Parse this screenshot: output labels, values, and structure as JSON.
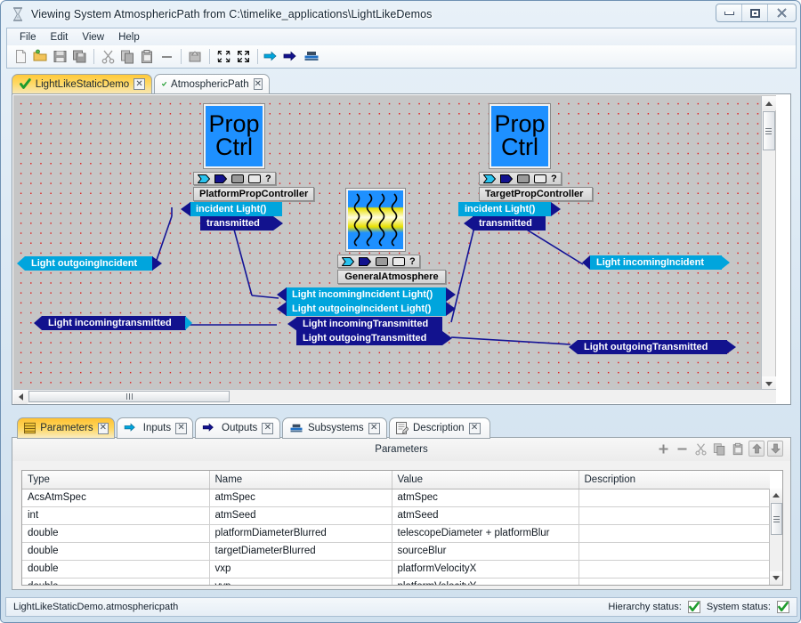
{
  "window": {
    "title": "Viewing System AtmosphericPath from C:\\timelike_applications\\LightLikeDemos",
    "title_icon": "hourglass-icon",
    "minimize_label": "Minimize",
    "maximize_label": "Maximize",
    "close_label": "Close"
  },
  "menu": {
    "items": [
      "File",
      "Edit",
      "View",
      "Help"
    ]
  },
  "toolbar": {
    "buttons": [
      {
        "name": "new-icon",
        "title": "New"
      },
      {
        "name": "open-folder-icon",
        "title": "Open"
      },
      {
        "name": "save-icon",
        "title": "Save"
      },
      {
        "name": "save-all-icon",
        "title": "Save All"
      },
      {
        "name": "cut-icon",
        "title": "Cut"
      },
      {
        "name": "copy-icon",
        "title": "Copy"
      },
      {
        "name": "paste-icon",
        "title": "Paste"
      },
      {
        "name": "delete-icon",
        "title": "Delete"
      },
      {
        "name": "promote-icon",
        "title": "Promote"
      },
      {
        "name": "collapse-icon",
        "title": "Collapse"
      },
      {
        "name": "expand-icon",
        "title": "Expand"
      },
      {
        "name": "input-port-icon",
        "title": "Add Input"
      },
      {
        "name": "output-port-icon",
        "title": "Add Output"
      },
      {
        "name": "subsystem-icon",
        "title": "Add Subsystem"
      }
    ]
  },
  "editor_tabs": [
    {
      "label": "LightLikeStaticDemo",
      "active": true,
      "status_icon": "green-check-icon",
      "close_icon": "close-icon"
    },
    {
      "label": "AtmosphericPath",
      "active": false,
      "status_icon": "green-check-icon",
      "close_icon": "close-icon"
    }
  ],
  "diagram": {
    "blocks": [
      {
        "id": "platform",
        "icon_lines": [
          "Prop",
          "Ctrl"
        ],
        "name": "PlatformPropController",
        "ports": [
          {
            "label": "incident  Light()",
            "style": "cyan",
            "dir": "in"
          },
          {
            "label": "transmitted",
            "style": "navy",
            "dir": "out"
          }
        ]
      },
      {
        "id": "atmosphere",
        "icon_lines": [],
        "name": "GeneralAtmosphere",
        "ports": [
          {
            "label": "Light  incomingIncident  Light()",
            "style": "cyan",
            "dir": "in"
          },
          {
            "label": "Light  outgoingIncident   Light()",
            "style": "cyan",
            "dir": "out"
          },
          {
            "label": "Light  incomingTransmitted",
            "style": "navy",
            "dir": "in"
          },
          {
            "label": "Light  outgoingTransmitted",
            "style": "navy",
            "dir": "out"
          }
        ]
      },
      {
        "id": "target",
        "icon_lines": [
          "Prop",
          "Ctrl"
        ],
        "name": "TargetPropController",
        "ports": [
          {
            "label": "incident  Light()",
            "style": "cyan",
            "dir": "in"
          },
          {
            "label": "transmitted",
            "style": "navy",
            "dir": "out"
          }
        ]
      }
    ],
    "system_ports": [
      {
        "label": "Light  outgoingIncident",
        "style": "cyan",
        "side": "left"
      },
      {
        "label": "Light  incomingtransmitted",
        "style": "navy",
        "side": "left"
      },
      {
        "label": "Light  incomingIncident",
        "style": "cyan",
        "side": "right"
      },
      {
        "label": "Light  outgoingTransmitted",
        "style": "navy",
        "side": "right"
      }
    ],
    "port_chip_legend": [
      "input-port-chip",
      "output-port-chip",
      "state-chip",
      "parameter-chip",
      "question-chip"
    ]
  },
  "bottom_tabs": [
    {
      "label": "Parameters",
      "active": true,
      "icon": "table-icon",
      "close_icon": "close-icon"
    },
    {
      "label": "Inputs",
      "active": false,
      "icon": "input-port-icon",
      "close_icon": "close-icon"
    },
    {
      "label": "Outputs",
      "active": false,
      "icon": "output-port-icon",
      "close_icon": "close-icon"
    },
    {
      "label": "Subsystems",
      "active": false,
      "icon": "subsystem-icon",
      "close_icon": "close-icon"
    },
    {
      "label": "Description",
      "active": false,
      "icon": "description-icon",
      "close_icon": "close-icon"
    }
  ],
  "panel": {
    "title": "Parameters",
    "tools": [
      {
        "name": "add-icon",
        "label": "+"
      },
      {
        "name": "remove-icon",
        "label": "−"
      },
      {
        "name": "cut-icon",
        "label": ""
      },
      {
        "name": "copy-icon",
        "label": ""
      },
      {
        "name": "paste-icon",
        "label": ""
      },
      {
        "name": "move-up-icon",
        "label": ""
      },
      {
        "name": "move-down-icon",
        "label": ""
      }
    ],
    "columns": [
      "Type",
      "Name",
      "Value",
      "Description"
    ],
    "rows": [
      {
        "type": "AcsAtmSpec",
        "name": "atmSpec",
        "value": "atmSpec",
        "description": ""
      },
      {
        "type": "int",
        "name": "atmSeed",
        "value": "atmSeed",
        "description": ""
      },
      {
        "type": "double",
        "name": "platformDiameterBlurred",
        "value": "telescopeDiameter  + platformBlur",
        "description": ""
      },
      {
        "type": "double",
        "name": "targetDiameterBlurred",
        "value": "sourceBlur",
        "description": ""
      },
      {
        "type": "double",
        "name": "vxp",
        "value": "platformVelocityX",
        "description": ""
      },
      {
        "type": "double",
        "name": "vyp",
        "value": "platformVelocityY",
        "description": ""
      }
    ]
  },
  "statusbar": {
    "path": "LightLikeStaticDemo.atmosphericpath",
    "hierarchy_label": "Hierarchy status:",
    "system_label": "System status:",
    "hierarchy_ok": "ok",
    "system_ok": "ok"
  },
  "colors": {
    "cyan_port": "#00a5dd",
    "navy_port": "#12128e",
    "icon_blue": "#1e90ff",
    "canvas": "#c6c6c6",
    "grid_dot": "#e02020",
    "tab_active": "#ffc93a",
    "wire": "#141496"
  }
}
